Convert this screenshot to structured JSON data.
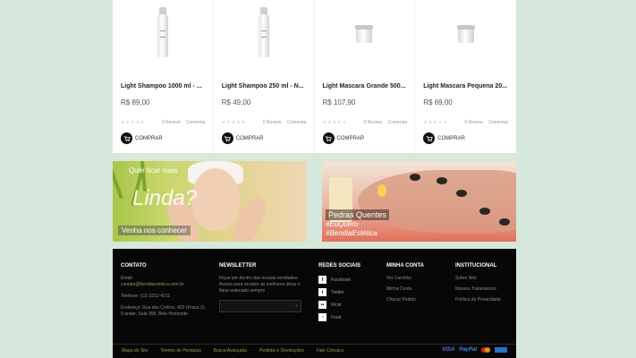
{
  "products": [
    {
      "name": "Light Shampoo 1000 ml - ...",
      "price": "R$ 89,00",
      "reviews": "0 Review",
      "comments": "Comentar",
      "buy_label": "COMPRAR",
      "image": "bottle"
    },
    {
      "name": "Light Shampoo 250 ml - N...",
      "price": "R$ 49,00",
      "reviews": "0 Review",
      "comments": "Comentar",
      "buy_label": "COMPRAR",
      "image": "bottle"
    },
    {
      "name": "Light Mascara Grande 500...",
      "price": "R$ 107,90",
      "reviews": "0 Review",
      "comments": "Comentar",
      "buy_label": "COMPRAR",
      "image": "jar"
    },
    {
      "name": "Light Mascara Pequena 20...",
      "price": "R$ 69,00",
      "reviews": "0 Review",
      "comments": "Comentar",
      "buy_label": "COMPRAR",
      "image": "jar"
    }
  ],
  "banners": {
    "left": {
      "tagline": "Quer ficar mais",
      "headline": "Linda?",
      "subtitle": "Venha nos conhecer"
    },
    "right": {
      "title": "Pedras Quentes",
      "tag1": "#EuQuero",
      "tag2": "#BendiaEstética"
    }
  },
  "footer": {
    "contact": {
      "title": "CONTATO",
      "email_label": "Email:",
      "email": "contato@bendiaestetica.com.br",
      "phone": "Telefone: (11) 3212-4211",
      "address": "Endereço: Rua dos Cedros, 420 (Praça Z), 9 andar, Sala 908, Belo Horizonte"
    },
    "newsletter": {
      "title": "NEWSLETTER",
      "text": "Fique por dentro das nossas novidades. Assine para receber as melhores dicas e fique antenado sempre",
      "placeholder": "",
      "submit": "›"
    },
    "social": {
      "title": "REDES SOCIAIS",
      "items": [
        {
          "label": "Facebook",
          "icon": "f"
        },
        {
          "label": "Twitter",
          "icon": "t"
        },
        {
          "label": "Flickr",
          "icon": "••"
        },
        {
          "label": "Feed",
          "icon": "rss"
        }
      ]
    },
    "account": {
      "title": "MINHA CONTA",
      "items": [
        "Ver Carrinho",
        "Minha Conta",
        "Checar Pedido"
      ]
    },
    "institutional": {
      "title": "INSTITUCIONAL",
      "items": [
        "Sobre Nós",
        "Nossos Tratamentos",
        "Política de Privacidade"
      ]
    },
    "bottom_links": [
      "Mapa do Site",
      "Termos de Pesquisa",
      "Busca Avançada",
      "Pedidos e Devoluções",
      "Fale Conosco"
    ],
    "payments": {
      "visa": "VISA",
      "paypal": "PayPal"
    }
  }
}
